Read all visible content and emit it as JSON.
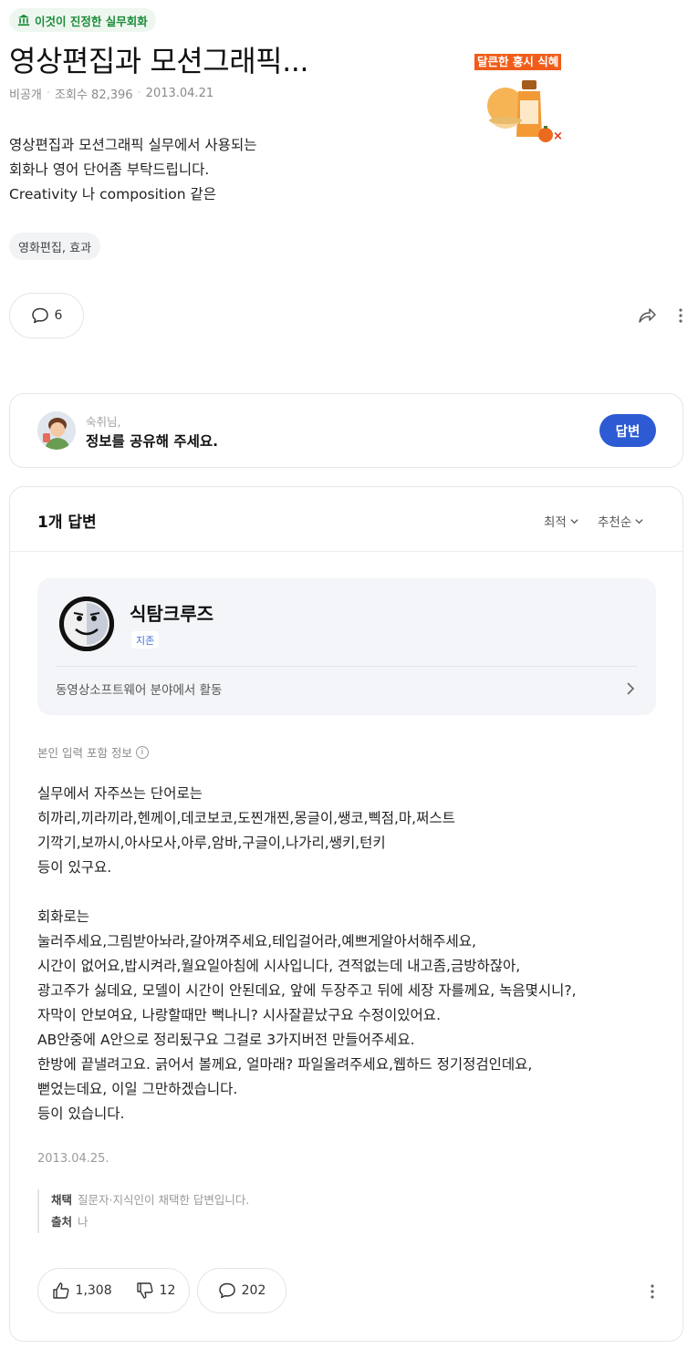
{
  "question": {
    "badge": "이것이 진정한 실무회화",
    "title": "영상편집과 모션그래픽...",
    "author": "비공개",
    "views_label": "조회수 82,396",
    "date": "2013.04.21",
    "body_lines": [
      "영상편집과 모션그래픽 실무에서 사용되는",
      "회화나 영어 단어좀 부탁드립니다.",
      "Creativity 나 composition 같은"
    ],
    "tag": "영화편집, 효과",
    "comment_count": "6"
  },
  "ad": {
    "label": "달큰한 홍시 식혜",
    "close": "×"
  },
  "prompt": {
    "user": "숙취님,",
    "text": "정보를 공유해 주세요.",
    "button": "답변"
  },
  "answers": {
    "count_label": "1개 답변",
    "sort_options": [
      "최적",
      "추천순"
    ],
    "expert": {
      "name": "식탐크루즈",
      "grade": "지존",
      "field": "동영상소프트웨어 분야에서 활동"
    },
    "info_label": "본인 입력 포함 정보",
    "body": "실무에서 자주쓰는 단어로는\n히까리,끼라끼라,헨께이,데코보코,도찐개찐,몽글이,쌩코,삑점,마,쩌스트\n기깍기,보까시,아사모사,아루,암바,구글이,나가리,쌩키,턴키\n등이 있구요.\n\n회화로는\n눌러주세요,그림받아놔라,갈아껴주세요,테입걸어라,예쁘게알아서해주세요,\n시간이 없어요,밥시켜라,월요일아침에 시사입니다, 견적없는데 내고좀,금방하잖아,\n광고주가 싫데요, 모델이 시간이 안된데요, 앞에 두장주고 뒤에 세장 자를께요, 녹음몇시니?,\n자막이 안보여요, 나랑할때만 뻑나니? 시사잘끝났구요 수정이있어요.\nAB안중에 A안으로 정리됬구요 그걸로 3가지버전 만들어주세요.\n한방에 끝낼려고요. 긁어서 볼께요, 얼마래? 파일올려주세요,웹하드 정기정검인데요,\n뻗었는데요, 이일 그만하겠습니다.\n등이 있습니다.",
    "date": "2013.04.25.",
    "adopt_key": "채택",
    "adopt_value": "질문자·지식인이 채택한 답변입니다.",
    "source_key": "출처",
    "source_value": "나",
    "likes": "1,308",
    "dislikes": "12",
    "comments": "202"
  },
  "colors": {
    "accent_green": "#1c8b3a",
    "answer_button": "#2d5bd3",
    "ad_orange": "#f05d1b"
  }
}
